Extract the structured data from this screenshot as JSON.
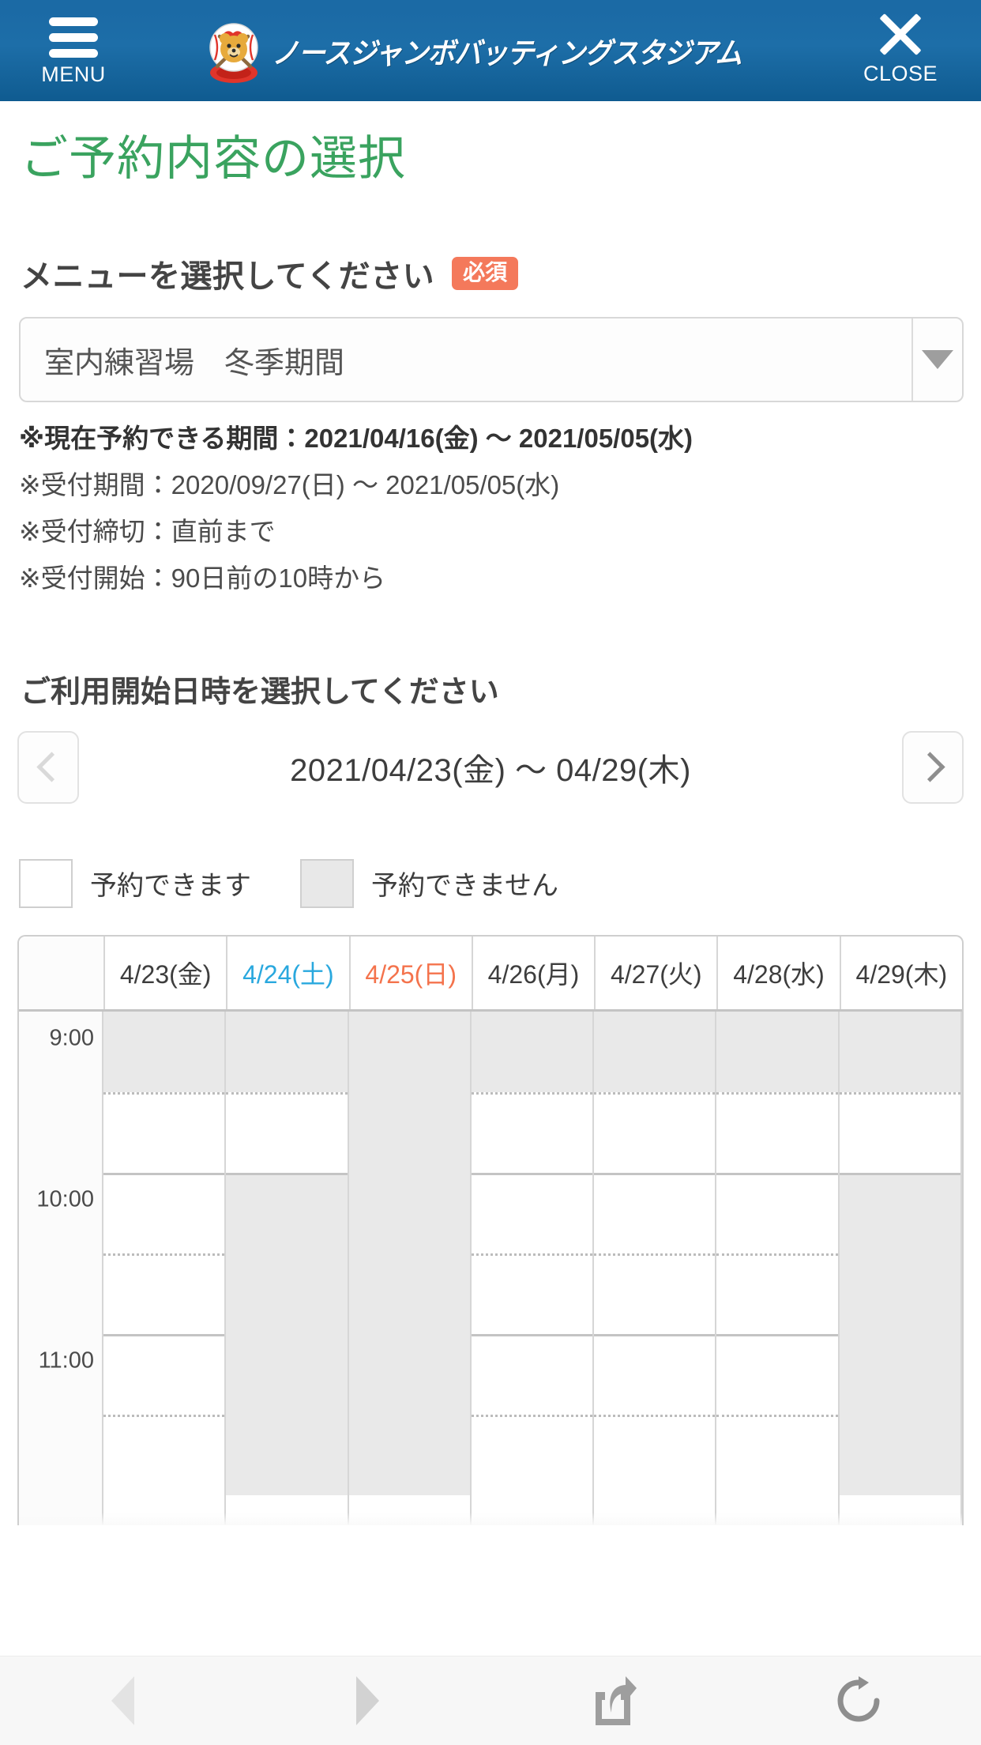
{
  "header": {
    "menu_label": "MENU",
    "close_label": "CLOSE",
    "brand_title": "ノースジャンボバッティングスタジアム"
  },
  "page_title": "ご予約内容の選択",
  "menu_section": {
    "heading": "メニューを選択してください",
    "required_badge": "必須",
    "selected_value": "室内練習場　冬季期間",
    "notes": [
      {
        "text": "※現在予約できる期間：2021/04/16(金) 〜 2021/05/05(水)",
        "bold": true
      },
      {
        "text": "※受付期間：2020/09/27(日) 〜 2021/05/05(水)",
        "bold": false
      },
      {
        "text": "※受付締切：直前まで",
        "bold": false
      },
      {
        "text": "※受付開始：90日前の10時から",
        "bold": false
      }
    ]
  },
  "datetime_section": {
    "heading": "ご利用開始日時を選択してください",
    "week_range": "2021/04/23(金) 〜 04/29(木)",
    "prev_label": "前の週へ",
    "next_label": "次の週へ"
  },
  "legend": [
    {
      "label": "予約できます",
      "state": "open"
    },
    {
      "label": "予約できません",
      "state": "closed"
    }
  ],
  "calendar": {
    "time_labels": [
      "9:00",
      "10:00",
      "11:00"
    ],
    "columns": [
      {
        "label": "4/23(金)",
        "day_type": "weekday"
      },
      {
        "label": "4/24(土)",
        "day_type": "saturday"
      },
      {
        "label": "4/25(日)",
        "day_type": "sunday"
      },
      {
        "label": "4/26(月)",
        "day_type": "weekday"
      },
      {
        "label": "4/27(火)",
        "day_type": "weekday"
      },
      {
        "label": "4/28(水)",
        "day_type": "weekday"
      },
      {
        "label": "4/29(木)",
        "day_type": "weekday"
      }
    ],
    "slots": [
      {
        "column": 0,
        "states": [
          "closed",
          "free",
          "free",
          "free",
          "free",
          "free"
        ]
      },
      {
        "column": 1,
        "states": [
          "closed",
          "free",
          "closed",
          "closed",
          "closed",
          "closed"
        ]
      },
      {
        "column": 2,
        "states": [
          "closed",
          "closed",
          "closed",
          "closed",
          "closed",
          "closed"
        ]
      },
      {
        "column": 3,
        "states": [
          "closed",
          "free",
          "free",
          "free",
          "free",
          "free"
        ]
      },
      {
        "column": 4,
        "states": [
          "closed",
          "free",
          "free",
          "free",
          "free",
          "free"
        ]
      },
      {
        "column": 5,
        "states": [
          "closed",
          "free",
          "free",
          "free",
          "free",
          "free"
        ]
      },
      {
        "column": 6,
        "states": [
          "closed",
          "free",
          "closed",
          "closed",
          "closed",
          "closed"
        ]
      }
    ]
  },
  "colors": {
    "header_blue": "#1b6aa5",
    "title_green": "#3aa35f",
    "required_orange": "#f4795b",
    "saturday_blue": "#29a8de",
    "sunday_red": "#f4734c",
    "closed_gray": "#e9e9e9"
  },
  "browser_bar": {
    "back_icon": "triangle-left-icon",
    "forward_icon": "triangle-right-icon",
    "share_icon": "share-icon",
    "reload_icon": "reload-icon"
  }
}
